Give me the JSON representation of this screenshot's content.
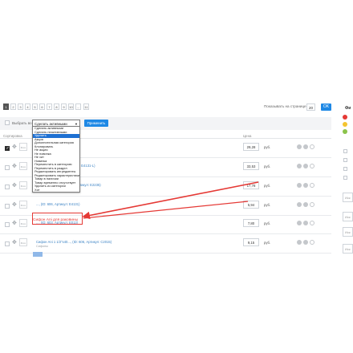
{
  "pagination": {
    "pages": [
      "1",
      "2",
      "3",
      "4",
      "5",
      "6",
      "7",
      "8",
      "9",
      "10",
      "...",
      "11"
    ],
    "active": "1",
    "per_page_label": "Показывать на странице",
    "per_page_value": "20",
    "ok_label": "OK"
  },
  "toolbar": {
    "select_all_label": "Выбрать все",
    "bulk_action_value": "Сделать активными",
    "apply_label": "Применить"
  },
  "columns": {
    "sort": "Сортировка",
    "price": "Цена"
  },
  "dropdown": {
    "items": [
      "Сделать активными",
      "Сделать неактивными",
      "Удалить",
      "Акция",
      "Дополнительная категория",
      "Клонировать",
      "Не акция",
      "Не новинка",
      "Не хит",
      "Новинка",
      "Переместить в категорию",
      "Переместить в раздел",
      "Редактировать ингредиенты",
      "Редактировать характеристики",
      "Товар в наличии",
      "Товар временно отсутствует",
      "Удалить из категории",
      "Хит"
    ],
    "selected_index": 2
  },
  "products": [
    {
      "name": "..., (ID: 609, Артикул: E1235)",
      "price": "29,28",
      "checked": true
    },
    {
      "name": "...ородов), (ID: 605, Артикул: Е4131-L)",
      "price": "33,53",
      "checked": false
    },
    {
      "name": "...ановлайный... (ID: 607, Артикул: E2235)",
      "price": "17,78",
      "checked": false
    },
    {
      "name": "..., (ID: 606, Артикул: Е4131)",
      "price": "5,94",
      "checked": false
    },
    {
      "name": "..., (ID: 603, Артикул: Е013)",
      "price": "7,80",
      "checked": false
    },
    {
      "name": "Сифон Ani 1 1/2\"x40..., (ID: 606, Артикул: C2015)",
      "sub": "Сифоны",
      "price": "9,15",
      "checked": false
    }
  ],
  "currency": "руб.",
  "callout_text": "Сифон Ani для раковины",
  "sidebar": {
    "title": "Фи"
  },
  "colors": {
    "accent": "#1e88e5",
    "annotation": "#e53935",
    "link": "#3b82c4"
  }
}
